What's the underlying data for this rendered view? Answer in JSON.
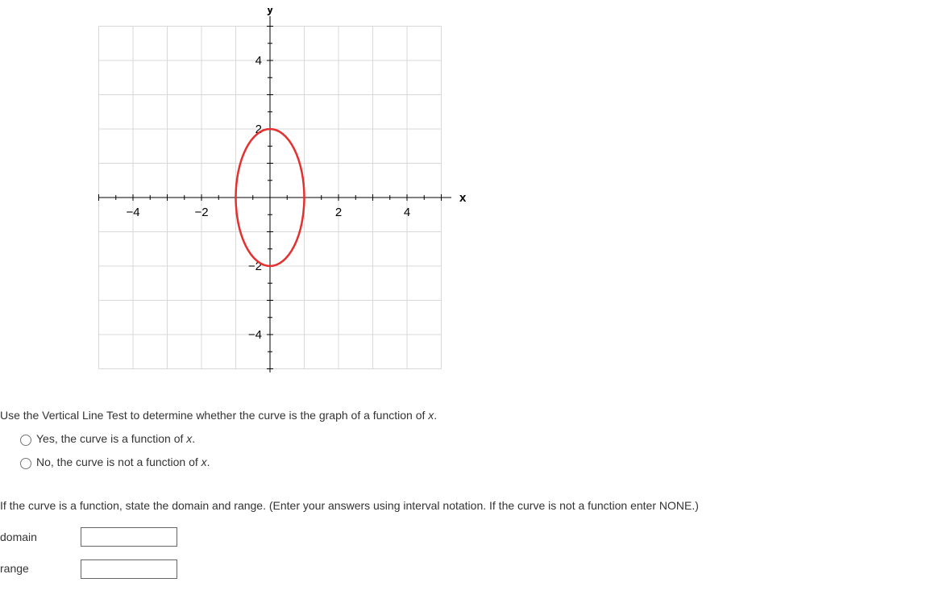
{
  "chart_data": {
    "type": "line",
    "title": "",
    "xlabel": "x",
    "ylabel": "y",
    "xlim": [
      -5,
      5
    ],
    "ylim": [
      -5,
      5
    ],
    "xticks": [
      -4,
      -2,
      2,
      4
    ],
    "yticks": [
      -4,
      -2,
      2,
      4
    ],
    "shape": {
      "kind": "ellipse",
      "center_x": 0,
      "center_y": 0,
      "rx": 1,
      "ry": 2,
      "stroke": "#e4302f",
      "fill": "none"
    }
  },
  "question1": {
    "prompt_pre": "Use the Vertical Line Test to determine whether the curve is the graph of a function of ",
    "prompt_var": "x",
    "prompt_post": ".",
    "opt_yes_pre": "Yes, the curve is a function of ",
    "opt_yes_var": "x",
    "opt_yes_post": ".",
    "opt_no_pre": "No, the curve is not a function of ",
    "opt_no_var": "x",
    "opt_no_post": "."
  },
  "question2": {
    "prompt": "If the curve is a function, state the domain and range. (Enter your answers using interval notation. If the curve is not a function enter NONE.)",
    "domain_label": "domain",
    "range_label": "range",
    "domain_value": "",
    "range_value": ""
  },
  "axis_labels": {
    "x": "x",
    "y": "y",
    "xn4": "−4",
    "xn2": "−2",
    "x2": "2",
    "x4": "4",
    "yn4": "−4",
    "yn2": "−2",
    "y2": "2",
    "y4": "4"
  }
}
